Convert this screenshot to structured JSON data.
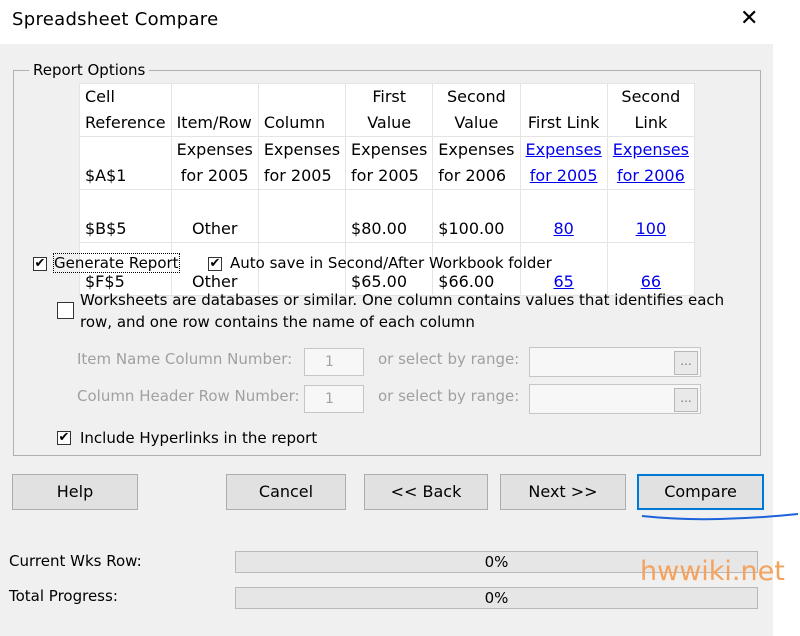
{
  "window": {
    "title": "Spreadsheet Compare",
    "close_glyph": "✕"
  },
  "report_options": {
    "legend": "Report Options",
    "table": {
      "headers": [
        [
          "Cell",
          "Reference"
        ],
        [
          "",
          "Item/Row"
        ],
        [
          "",
          "Column"
        ],
        [
          "First",
          "Value"
        ],
        [
          "Second",
          "Value"
        ],
        [
          "",
          "First Link"
        ],
        [
          "Second",
          "Link"
        ]
      ],
      "rows": [
        [
          [
            "",
            "$A$1"
          ],
          [
            "Expenses",
            "for 2005"
          ],
          [
            "Expenses",
            "for 2005"
          ],
          [
            "Expenses",
            "for 2005"
          ],
          [
            "Expenses",
            "for 2006"
          ],
          [
            "Expenses",
            "for 2005"
          ],
          [
            "Expenses",
            "for 2006"
          ]
        ],
        [
          [
            "",
            "$B$5"
          ],
          [
            "",
            "Other"
          ],
          [
            "",
            ""
          ],
          [
            "",
            "$80.00"
          ],
          [
            "",
            "$100.00"
          ],
          [
            "",
            "80"
          ],
          [
            "",
            "100"
          ]
        ],
        [
          [
            "",
            "$F$5"
          ],
          [
            "",
            "Other"
          ],
          [
            "",
            ""
          ],
          [
            "",
            "$65.00"
          ],
          [
            "",
            "$66.00"
          ],
          [
            "",
            "65"
          ],
          [
            "",
            "66"
          ]
        ]
      ]
    },
    "generate_report": {
      "label": "Generate Report",
      "checked": true
    },
    "auto_save": {
      "label": "Auto save in Second/After Workbook folder",
      "checked": true
    },
    "worksheets_db": {
      "label_line1": "Worksheets are databases or similar. One column contains values that identifies each",
      "label_line2": "row, and one row contains the name of each column",
      "checked": false
    },
    "item_name_col": {
      "label": "Item Name Column Number:",
      "value": "1",
      "range_label": "or select by range:",
      "range_btn": "..."
    },
    "col_header_row": {
      "label": "Column Header Row Number:",
      "value": "1",
      "range_label": "or select by range:",
      "range_btn": "..."
    },
    "include_hyperlinks": {
      "label": "Include Hyperlinks in the report",
      "checked": true
    }
  },
  "buttons": {
    "help": "Help",
    "cancel": "Cancel",
    "back": "<< Back",
    "next": "Next >>",
    "compare": "Compare"
  },
  "progress": {
    "current_label": "Current Wks Row:",
    "current_value": 0,
    "current_text": "0%",
    "total_label": "Total Progress:",
    "total_value": 0,
    "total_text": "0%"
  },
  "watermark": "hwwiki.net"
}
